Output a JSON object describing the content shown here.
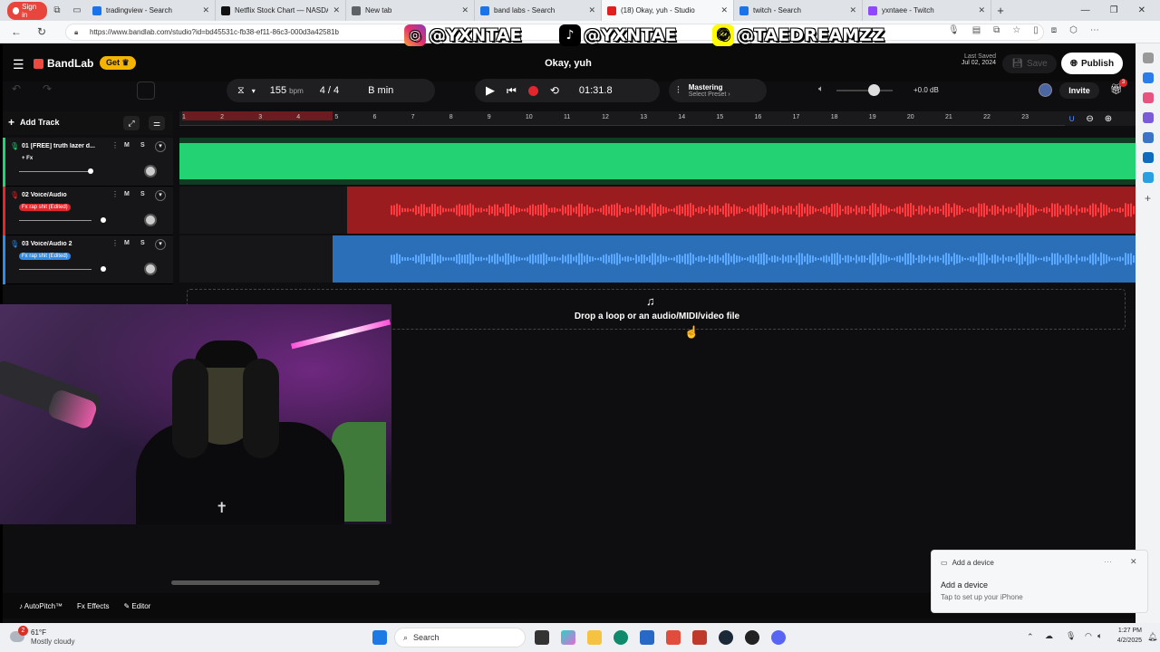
{
  "browser": {
    "signin": "Sign in",
    "tabs": [
      {
        "label": "tradingview - Search",
        "color": "#1a73e8"
      },
      {
        "label": "Netflix Stock Chart — NASDA",
        "color": "#111111"
      },
      {
        "label": "New tab",
        "color": "#5f6368"
      },
      {
        "label": "band labs - Search",
        "color": "#1a73e8"
      },
      {
        "label": "(18) Okay, yuh - Studio",
        "color": "#e02020"
      },
      {
        "label": "twitch - Search",
        "color": "#1a73e8"
      },
      {
        "label": "yxntaee - Twitch",
        "color": "#9146ff"
      }
    ],
    "url": "https://www.bandlab.com/studio?id=bd45531c-fb38-ef11-86c3-000d3a42581b"
  },
  "overlay": {
    "instagram": "@YXNTAE",
    "tiktok": "@YXNTAE",
    "snapchat": "@TAEDREAMZZ"
  },
  "app": {
    "logo": "BandLab",
    "get_label": "Get",
    "project_title": "Okay, yuh",
    "last_saved_label": "Last Saved",
    "last_saved_date": "Jul 02, 2024",
    "save_label": "Save",
    "publish_label": "Publish",
    "bpm_value": "155",
    "bpm_unit": "bpm",
    "time_signature": "4 / 4",
    "key": "B min",
    "time": "01:31.8",
    "mastering_label": "Mastering",
    "mastering_sub": "Select Preset",
    "volume_db": "+0.0 dB",
    "invite_label": "Invite",
    "gift_badge": "3",
    "add_track_label": "Add Track",
    "ruler": [
      "1",
      "2",
      "3",
      "4",
      "5",
      "6",
      "7",
      "8",
      "9",
      "10",
      "11",
      "12",
      "13",
      "14",
      "15",
      "16",
      "17",
      "18",
      "19",
      "20",
      "21",
      "22",
      "23"
    ],
    "tracks": [
      {
        "name": "01  [FREE] truth lazer d...",
        "fx": "+ Fx",
        "color": "#22d273",
        "mute": "M",
        "solo": "S"
      },
      {
        "name": "02  Voice/Audio",
        "fx": "Fx rap shit (Edited)",
        "color": "#e3262b",
        "mute": "M",
        "solo": "S"
      },
      {
        "name": "03  Voice/Audio 2",
        "fx": "Fx rap shit (Edited)",
        "color": "#2f8be6",
        "mute": "M",
        "solo": "S"
      }
    ],
    "drop_text": "Drop a loop or an audio/MIDI/video file",
    "bottom": {
      "autopitch": "AutoPitch™",
      "effects": "Effects",
      "editor": "Editor"
    }
  },
  "toast": {
    "header": "Add a device",
    "title": "Add a device",
    "body": "Tap to set up your iPhone"
  },
  "taskbar": {
    "weather_temp": "61°F",
    "weather_desc": "Mostly cloudy",
    "weather_badge": "2",
    "search_placeholder": "Search",
    "time": "1:27 PM",
    "date": "4/2/2025"
  }
}
